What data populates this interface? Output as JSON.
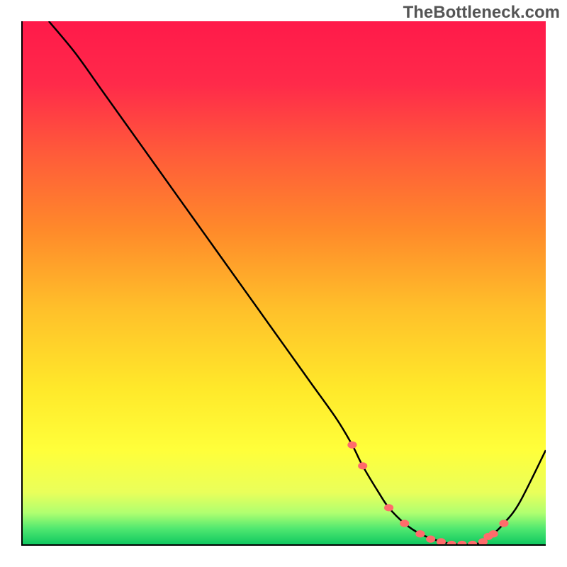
{
  "watermark": "TheBottleneck.com",
  "chart_data": {
    "type": "line",
    "title": "",
    "xlabel": "",
    "ylabel": "",
    "xlim": [
      0,
      100
    ],
    "ylim": [
      0,
      100
    ],
    "gradient_stops": [
      {
        "pos": 0.0,
        "color": "#ff1a4a"
      },
      {
        "pos": 0.12,
        "color": "#ff2a4a"
      },
      {
        "pos": 0.25,
        "color": "#ff5a3a"
      },
      {
        "pos": 0.4,
        "color": "#ff8a2a"
      },
      {
        "pos": 0.55,
        "color": "#ffc02a"
      },
      {
        "pos": 0.7,
        "color": "#ffe82a"
      },
      {
        "pos": 0.82,
        "color": "#ffff3a"
      },
      {
        "pos": 0.9,
        "color": "#eaff5a"
      },
      {
        "pos": 0.94,
        "color": "#b0ff70"
      },
      {
        "pos": 0.97,
        "color": "#50e870"
      },
      {
        "pos": 1.0,
        "color": "#10c860"
      }
    ],
    "series": [
      {
        "name": "bottleneck-curve",
        "x": [
          5,
          10,
          15,
          20,
          25,
          30,
          35,
          40,
          45,
          50,
          55,
          60,
          63,
          65,
          68,
          70,
          73,
          76,
          80,
          83,
          86,
          88,
          90,
          92,
          95,
          100
        ],
        "values": [
          100,
          94,
          87,
          80,
          73,
          66,
          59,
          52,
          45,
          38,
          31,
          24,
          19,
          15,
          10,
          7,
          4,
          2,
          0.5,
          0,
          0,
          0.5,
          2,
          4,
          8,
          18
        ]
      }
    ],
    "markers": {
      "name": "highlight-points",
      "color": "#ff6b6b",
      "radius": 6,
      "points": [
        {
          "x": 63,
          "y": 19
        },
        {
          "x": 65,
          "y": 15
        },
        {
          "x": 70,
          "y": 7
        },
        {
          "x": 73,
          "y": 4
        },
        {
          "x": 76,
          "y": 2
        },
        {
          "x": 78,
          "y": 1
        },
        {
          "x": 80,
          "y": 0.5
        },
        {
          "x": 82,
          "y": 0
        },
        {
          "x": 84,
          "y": 0
        },
        {
          "x": 86,
          "y": 0
        },
        {
          "x": 88,
          "y": 0.5
        },
        {
          "x": 89,
          "y": 1.5
        },
        {
          "x": 90,
          "y": 2
        },
        {
          "x": 92,
          "y": 4
        }
      ]
    }
  }
}
